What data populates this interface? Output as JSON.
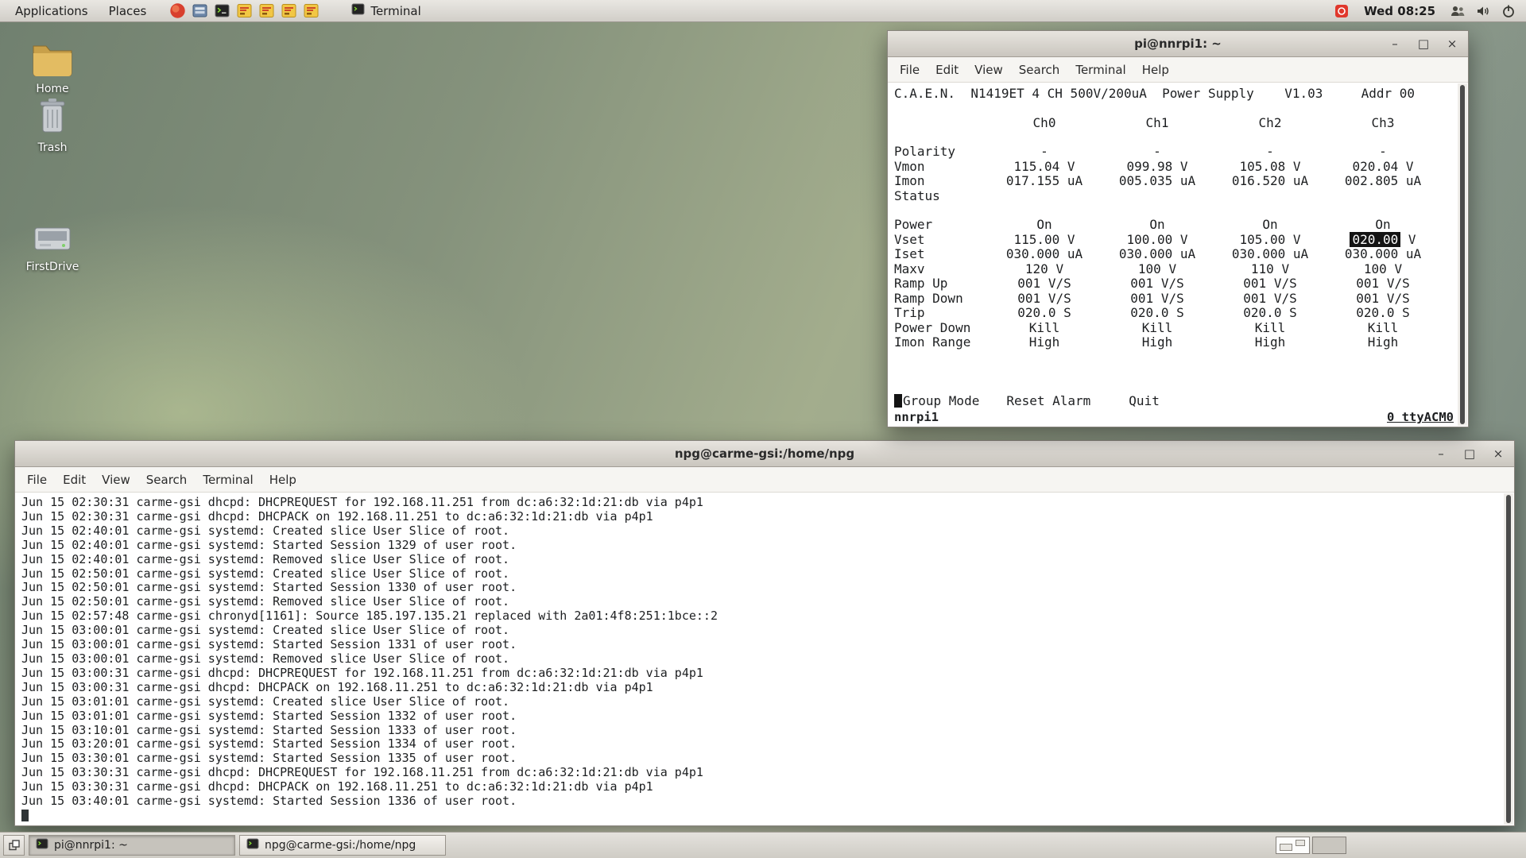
{
  "colors": {
    "wallpaper_green": "#8e9b84",
    "panel_bg": "#d8d5cf",
    "terminal_bg": "#ffffff",
    "terminal_fg": "#1d1f21",
    "highlight_bg": "#141414",
    "highlight_fg": "#ffffff",
    "tray_badge_red": "#e0382c",
    "folder_icon_tan": "#e3bc62"
  },
  "panel": {
    "menu_applications": "Applications",
    "menu_places": "Places",
    "active_app": "Terminal",
    "clock": "Wed 08:25"
  },
  "desktop": {
    "icons": [
      {
        "label": "Home"
      },
      {
        "label": "Trash"
      },
      {
        "label": "FirstDrive"
      }
    ]
  },
  "terminal_menu": [
    "File",
    "Edit",
    "View",
    "Search",
    "Terminal",
    "Help"
  ],
  "window_controls": {
    "minimize": "–",
    "maximize": "□",
    "close": "×"
  },
  "term1": {
    "title": "pi@nnrpi1: ~",
    "header_line": "C.A.E.N.  N1419ET 4 CH 500V/200uA  Power Supply    V1.03     Addr 00",
    "channels": [
      "Ch0",
      "Ch1",
      "Ch2",
      "Ch3"
    ],
    "rows": [
      {
        "label": "Polarity",
        "values": [
          "-",
          "-",
          "-",
          "-"
        ]
      },
      {
        "label": "Vmon",
        "values": [
          "115.04 V",
          "099.98 V",
          "105.08 V",
          "020.04 V"
        ]
      },
      {
        "label": "Imon",
        "values": [
          "017.155 uA",
          "005.035 uA",
          "016.520 uA",
          "002.805 uA"
        ]
      },
      {
        "label": "Status",
        "values": [
          "",
          "",
          "",
          ""
        ]
      },
      {
        "label": "Power",
        "values": [
          "On",
          "On",
          "On",
          "On"
        ]
      },
      {
        "label": "Vset",
        "values": [
          "115.00 V",
          "100.00 V",
          "105.00 V"
        ],
        "highlighted_value": "020.00",
        "highlighted_suffix": " V"
      },
      {
        "label": "Iset",
        "values": [
          "030.000 uA",
          "030.000 uA",
          "030.000 uA",
          "030.000 uA"
        ]
      },
      {
        "label": "Maxv",
        "values": [
          "120 V",
          "100 V",
          "110 V",
          "100 V"
        ]
      },
      {
        "label": "Ramp Up",
        "values": [
          "001 V/S",
          "001 V/S",
          "001 V/S",
          "001 V/S"
        ]
      },
      {
        "label": "Ramp Down",
        "values": [
          "001 V/S",
          "001 V/S",
          "001 V/S",
          "001 V/S"
        ]
      },
      {
        "label": "Trip",
        "values": [
          "020.0 S",
          "020.0 S",
          "020.0 S",
          "020.0 S"
        ]
      },
      {
        "label": "Power Down",
        "values": [
          "Kill",
          "Kill",
          "Kill",
          "Kill"
        ]
      },
      {
        "label": "Imon Range",
        "values": [
          "High",
          "High",
          "High",
          "High"
        ]
      }
    ],
    "footer_menu": [
      "Group Mode",
      "Reset Alarm",
      "Quit"
    ],
    "status_left": "nnrpi1",
    "status_right": "0 ttyACM0"
  },
  "term2": {
    "title": "npg@carme-gsi:/home/npg",
    "log_lines": [
      "Jun 15 02:30:31 carme-gsi dhcpd: DHCPREQUEST for 192.168.11.251 from dc:a6:32:1d:21:db via p4p1",
      "Jun 15 02:30:31 carme-gsi dhcpd: DHCPACK on 192.168.11.251 to dc:a6:32:1d:21:db via p4p1",
      "Jun 15 02:40:01 carme-gsi systemd: Created slice User Slice of root.",
      "Jun 15 02:40:01 carme-gsi systemd: Started Session 1329 of user root.",
      "Jun 15 02:40:01 carme-gsi systemd: Removed slice User Slice of root.",
      "Jun 15 02:50:01 carme-gsi systemd: Created slice User Slice of root.",
      "Jun 15 02:50:01 carme-gsi systemd: Started Session 1330 of user root.",
      "Jun 15 02:50:01 carme-gsi systemd: Removed slice User Slice of root.",
      "Jun 15 02:57:48 carme-gsi chronyd[1161]: Source 185.197.135.21 replaced with 2a01:4f8:251:1bce::2",
      "Jun 15 03:00:01 carme-gsi systemd: Created slice User Slice of root.",
      "Jun 15 03:00:01 carme-gsi systemd: Started Session 1331 of user root.",
      "Jun 15 03:00:01 carme-gsi systemd: Removed slice User Slice of root.",
      "Jun 15 03:00:31 carme-gsi dhcpd: DHCPREQUEST for 192.168.11.251 from dc:a6:32:1d:21:db via p4p1",
      "Jun 15 03:00:31 carme-gsi dhcpd: DHCPACK on 192.168.11.251 to dc:a6:32:1d:21:db via p4p1",
      "Jun 15 03:01:01 carme-gsi systemd: Created slice User Slice of root.",
      "Jun 15 03:01:01 carme-gsi systemd: Started Session 1332 of user root.",
      "Jun 15 03:10:01 carme-gsi systemd: Started Session 1333 of user root.",
      "Jun 15 03:20:01 carme-gsi systemd: Started Session 1334 of user root.",
      "Jun 15 03:30:01 carme-gsi systemd: Started Session 1335 of user root.",
      "Jun 15 03:30:31 carme-gsi dhcpd: DHCPREQUEST for 192.168.11.251 from dc:a6:32:1d:21:db via p4p1",
      "Jun 15 03:30:31 carme-gsi dhcpd: DHCPACK on 192.168.11.251 to dc:a6:32:1d:21:db via p4p1",
      "Jun 15 03:40:01 carme-gsi systemd: Started Session 1336 of user root."
    ]
  },
  "taskbar": {
    "buttons": [
      {
        "label": "pi@nnrpi1: ~"
      },
      {
        "label": "npg@carme-gsi:/home/npg"
      }
    ]
  }
}
